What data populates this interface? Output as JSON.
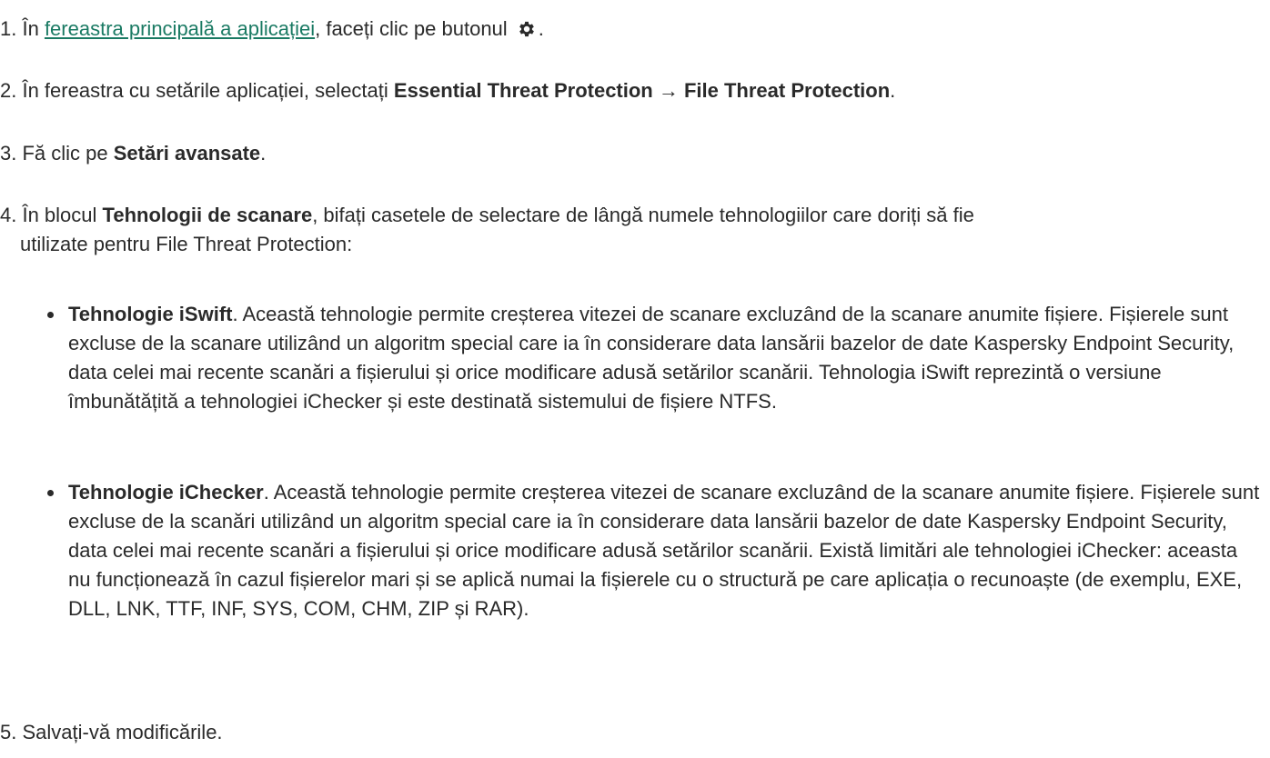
{
  "steps": [
    {
      "num": "1.",
      "pre": " În ",
      "link": "fereastra principală a aplicației",
      "mid": ", faceți clic pe butonul ",
      "post": ".",
      "icon": "gear-icon"
    },
    {
      "num": "2.",
      "pre": " În fereastra cu setările aplicației, selectați ",
      "b1": "Essential Threat Protection",
      "arrow": " → ",
      "b2": "File Threat Protection",
      "post": "."
    },
    {
      "num": "3.",
      "pre": " Fă clic pe ",
      "b1": "Setări avansate",
      "post": "."
    },
    {
      "num": "4.",
      "pre": " În blocul ",
      "b1": "Tehnologii de scanare",
      "line1_rest": ", bifați casetele de selectare de lângă numele tehnologiilor care doriți să fie",
      "line2": "utilizate pentru File Threat Protection:"
    },
    {
      "num": "5.",
      "text": " Salvați-vă modificările."
    }
  ],
  "bullets": [
    {
      "title": "Tehnologie iSwift",
      "text": ". Această tehnologie permite creșterea vitezei de scanare excluzând de la scanare anumite fișiere. Fișierele sunt excluse de la scanare utilizând un algoritm special care ia în considerare data lansării bazelor de date Kaspersky Endpoint Security, data celei mai recente scanări a fișierului și orice modificare adusă setărilor scanării. Tehnologia iSwift reprezintă o versiune îmbunătățită a tehnologiei iChecker și este destinată sistemului de fișiere NTFS."
    },
    {
      "title": "Tehnologie iChecker",
      "text": ". Această tehnologie permite creșterea vitezei de scanare excluzând de la scanare anumite fișiere. Fișierele sunt excluse de la scanări utilizând un algoritm special care ia în considerare data lansării bazelor de date Kaspersky Endpoint Security, data celei mai recente scanări a fișierului și orice modificare adusă setărilor scanării. Există limitări ale tehnologiei iChecker: aceasta nu funcționează în cazul fișierelor mari și se aplică numai la fișierele cu o structură pe care aplicația o recunoaște (de exemplu, EXE, DLL, LNK, TTF, INF, SYS, COM, CHM, ZIP și RAR)."
    }
  ]
}
